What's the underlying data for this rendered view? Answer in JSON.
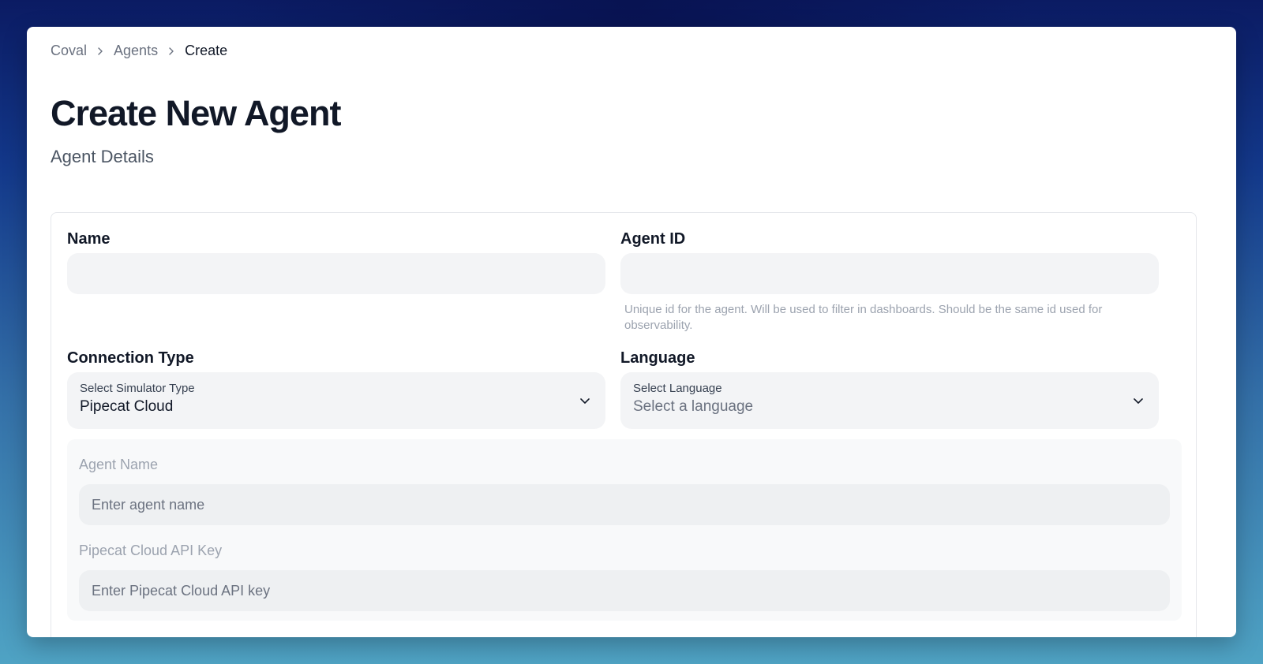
{
  "breadcrumb": {
    "items": [
      "Coval",
      "Agents"
    ],
    "current": "Create"
  },
  "page": {
    "title": "Create New Agent",
    "subtitle": "Agent Details"
  },
  "form": {
    "name": {
      "label": "Name",
      "value": "",
      "placeholder": ""
    },
    "agent_id": {
      "label": "Agent ID",
      "value": "",
      "placeholder": "",
      "help": "Unique id for the agent. Will be used to filter in dashboards. Should be the same id used for observability."
    },
    "connection_type": {
      "label": "Connection Type",
      "select_label": "Select Simulator Type",
      "selected": "Pipecat Cloud"
    },
    "language": {
      "label": "Language",
      "select_label": "Select Language",
      "selected": "Select a language"
    },
    "pipecat": {
      "agent_name": {
        "label": "Agent Name",
        "placeholder": "Enter agent name"
      },
      "api_key": {
        "label": "Pipecat Cloud API Key",
        "placeholder": "Enter Pipecat Cloud API key"
      }
    }
  },
  "icons": {
    "breadcrumb_separator": "chevron-right-icon",
    "select_arrow": "chevron-down-icon"
  }
}
